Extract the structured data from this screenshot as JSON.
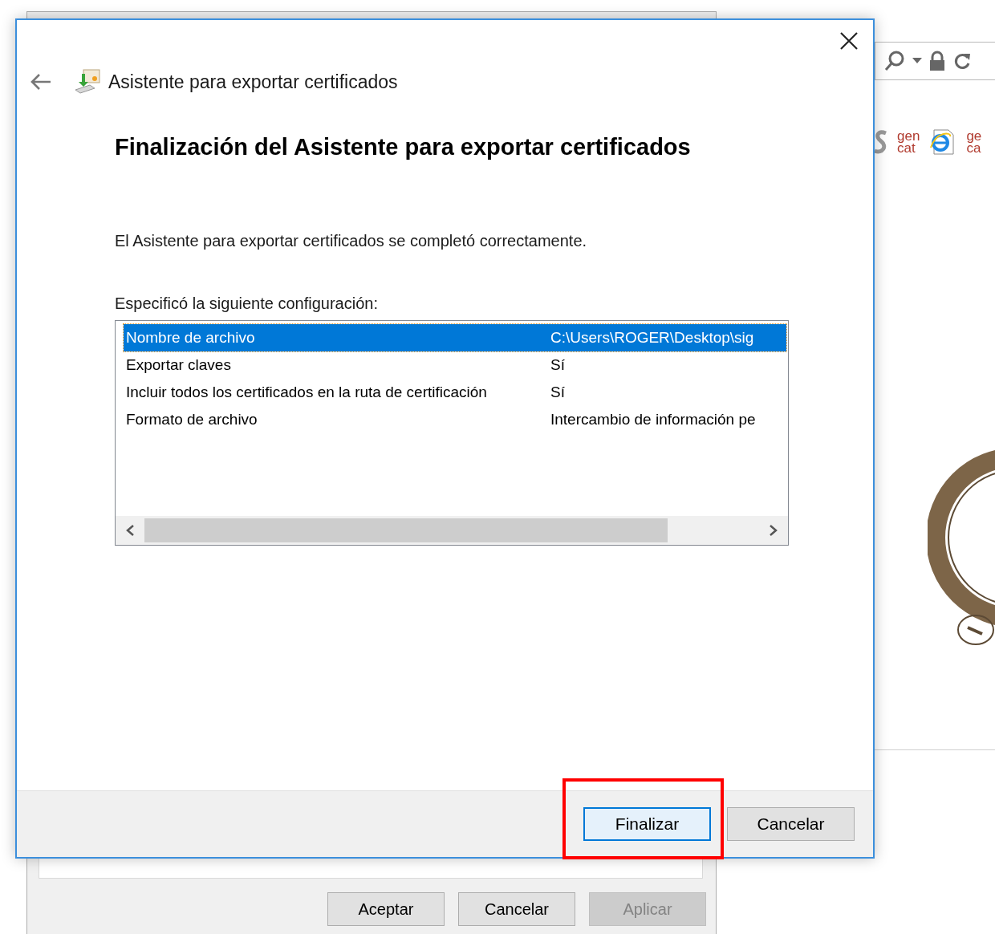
{
  "background_window": {
    "buttons": [
      {
        "label": "Aceptar",
        "disabled": false
      },
      {
        "label": "Cancelar",
        "disabled": false
      },
      {
        "label": "Aplicar",
        "disabled": true
      }
    ]
  },
  "browser": {
    "favorites": [
      {
        "lines": [
          "gen",
          "cat"
        ]
      },
      {
        "lines": [
          "ge",
          "ca"
        ]
      }
    ]
  },
  "dialog": {
    "title": "Asistente para exportar certificados",
    "heading": "Finalización del Asistente para exportar certificados",
    "message": "El Asistente para exportar certificados se completó correctamente.",
    "list_label": "Especificó la siguiente configuración:",
    "rows": [
      {
        "name": "Nombre de archivo",
        "value": "C:\\Users\\ROGER\\Desktop\\sig",
        "selected": true
      },
      {
        "name": "Exportar claves",
        "value": "Sí",
        "selected": false
      },
      {
        "name": "Incluir todos los certificados en la ruta de certificación",
        "value": "Sí",
        "selected": false
      },
      {
        "name": "Formato de archivo",
        "value": "Intercambio de información pe",
        "selected": false
      }
    ],
    "buttons": [
      {
        "label": "Finalizar",
        "default": true
      },
      {
        "label": "Cancelar",
        "default": false
      }
    ]
  }
}
